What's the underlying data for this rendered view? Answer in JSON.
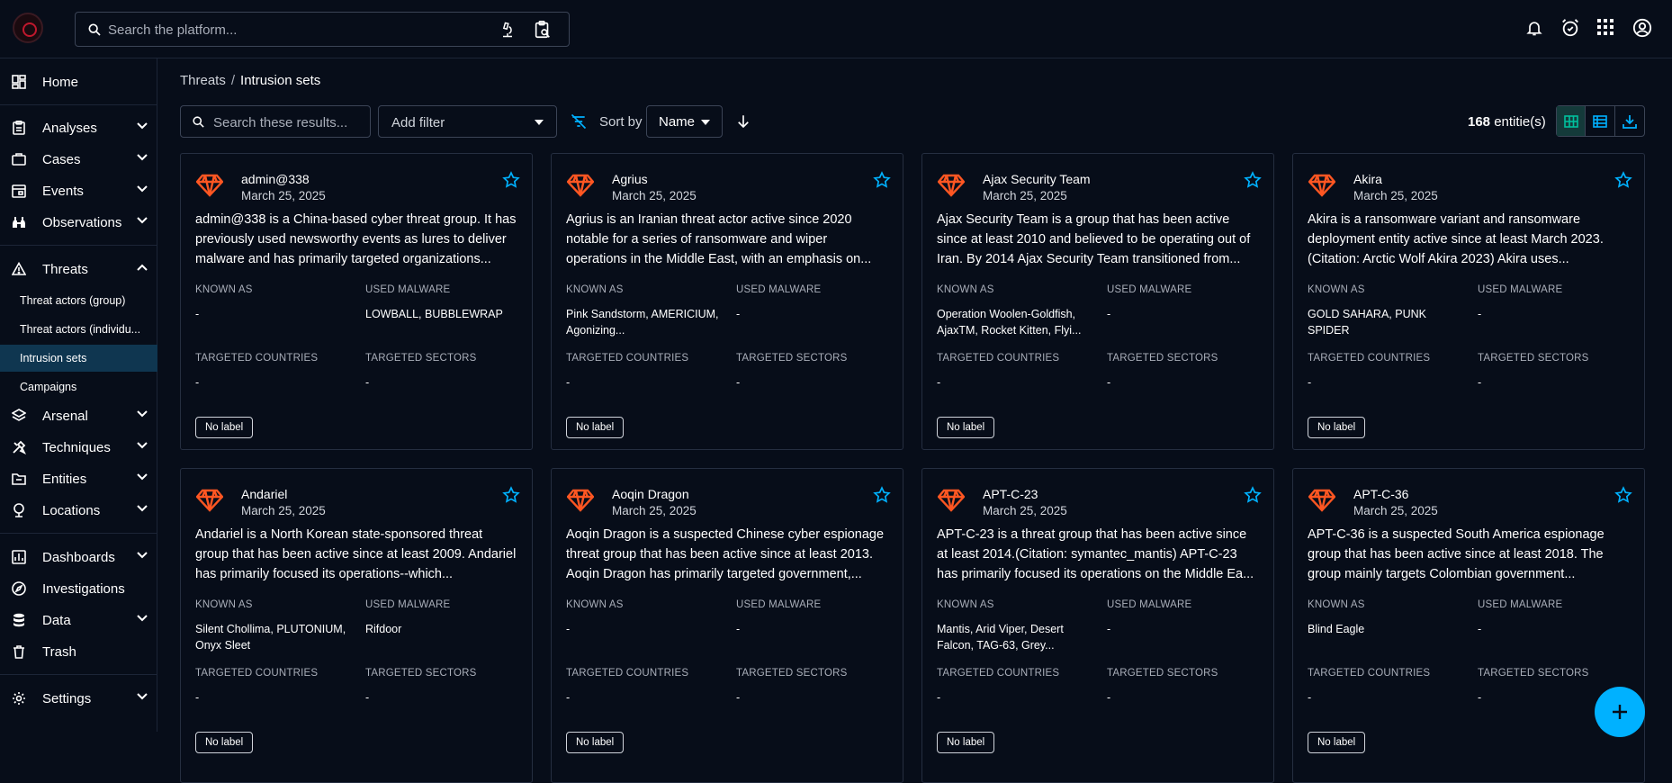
{
  "header": {
    "search_placeholder": "Search the platform...",
    "icons": [
      "bell-icon",
      "alarm-icon",
      "apps-grid-icon",
      "account-icon"
    ]
  },
  "sidebar": {
    "items": [
      {
        "label": "Home",
        "icon": "dashboard-icon"
      },
      {
        "label": "Analyses",
        "icon": "clipboard-icon"
      },
      {
        "label": "Cases",
        "icon": "briefcase-icon"
      },
      {
        "label": "Events",
        "icon": "calendar-icon"
      },
      {
        "label": "Observations",
        "icon": "binoculars-icon"
      },
      {
        "label": "Threats",
        "icon": "warning-icon"
      },
      {
        "label": "Arsenal",
        "icon": "layers-icon"
      },
      {
        "label": "Techniques",
        "icon": "tools-icon"
      },
      {
        "label": "Entities",
        "icon": "folder-icon"
      },
      {
        "label": "Locations",
        "icon": "globe-icon"
      },
      {
        "label": "Dashboards",
        "icon": "chart-icon"
      },
      {
        "label": "Investigations",
        "icon": "compass-icon"
      },
      {
        "label": "Data",
        "icon": "database-icon"
      },
      {
        "label": "Trash",
        "icon": "trash-icon"
      },
      {
        "label": "Settings",
        "icon": "gear-icon"
      }
    ],
    "threat_sub": [
      "Threat actors (group)",
      "Threat actors (individu...",
      "Intrusion sets",
      "Campaigns"
    ]
  },
  "breadcrumb": {
    "parent": "Threats",
    "separator": "/",
    "current": "Intrusion sets"
  },
  "toolbar": {
    "search_placeholder": "Search these results...",
    "filter_label": "Add filter",
    "sort_label": "Sort by",
    "sort_value": "Name",
    "count_value": "168",
    "count_suffix": " entitie(s)"
  },
  "field_labels": {
    "known_as": "KNOWN AS",
    "used_malware": "USED MALWARE",
    "targeted_countries": "TARGETED COUNTRIES",
    "targeted_sectors": "TARGETED SECTORS",
    "no_label": "No label"
  },
  "cards": [
    {
      "name": "admin@338",
      "date": "March 25, 2025",
      "description": "admin@338 is a China-based cyber threat group. It has previously used newsworthy events as lures to deliver malware and has primarily targeted organizations...",
      "known_as": "-",
      "used_malware": "LOWBALL, BUBBLEWRAP",
      "countries": "-",
      "sectors": "-"
    },
    {
      "name": "Agrius",
      "date": "March 25, 2025",
      "description": "Agrius is an Iranian threat actor active since 2020 notable for a series of ransomware and wiper operations in the Middle East, with an emphasis on...",
      "known_as": "Pink Sandstorm, AMERICIUM, Agonizing...",
      "used_malware": "-",
      "countries": "-",
      "sectors": "-"
    },
    {
      "name": "Ajax Security Team",
      "date": "March 25, 2025",
      "description": "Ajax Security Team is a group that has been active since at least 2010 and believed to be operating out of Iran. By 2014 Ajax Security Team transitioned from...",
      "known_as": "Operation Woolen-Goldfish, AjaxTM, Rocket Kitten, Flyi...",
      "used_malware": "-",
      "countries": "-",
      "sectors": "-"
    },
    {
      "name": "Akira",
      "date": "March 25, 2025",
      "description": "Akira is a ransomware variant and ransomware deployment entity active since at least March 2023. (Citation: Arctic Wolf Akira 2023) Akira uses...",
      "known_as": "GOLD SAHARA, PUNK SPIDER",
      "used_malware": "-",
      "countries": "-",
      "sectors": "-"
    },
    {
      "name": "Andariel",
      "date": "March 25, 2025",
      "description": "Andariel is a North Korean state-sponsored threat group that has been active since at least 2009. Andariel has primarily focused its operations--which...",
      "known_as": "Silent Chollima, PLUTONIUM, Onyx Sleet",
      "used_malware": "Rifdoor",
      "countries": "-",
      "sectors": "-"
    },
    {
      "name": "Aoqin Dragon",
      "date": "March 25, 2025",
      "description": "Aoqin Dragon is a suspected Chinese cyber espionage threat group that has been active since at least 2013. Aoqin Dragon has primarily targeted government,...",
      "known_as": "-",
      "used_malware": "-",
      "countries": "-",
      "sectors": "-"
    },
    {
      "name": "APT-C-23",
      "date": "March 25, 2025",
      "description": "APT-C-23 is a threat group that has been active since at least 2014.(Citation: symantec_mantis) APT-C-23 has primarily focused its operations on the Middle Ea...",
      "known_as": "Mantis, Arid Viper, Desert Falcon, TAG-63, Grey...",
      "used_malware": "-",
      "countries": "-",
      "sectors": "-"
    },
    {
      "name": "APT-C-36",
      "date": "March 25, 2025",
      "description": "APT-C-36 is a suspected South America espionage group that has been active since at least 2018. The group mainly targets Colombian government...",
      "known_as": "Blind Eagle",
      "used_malware": "-",
      "countries": "-",
      "sectors": "-"
    }
  ],
  "colors": {
    "accent": "#00b1ff",
    "intrusion_icon": "#ff5622",
    "active_nav": "#0f3650",
    "grid_active": "#00c09d"
  }
}
